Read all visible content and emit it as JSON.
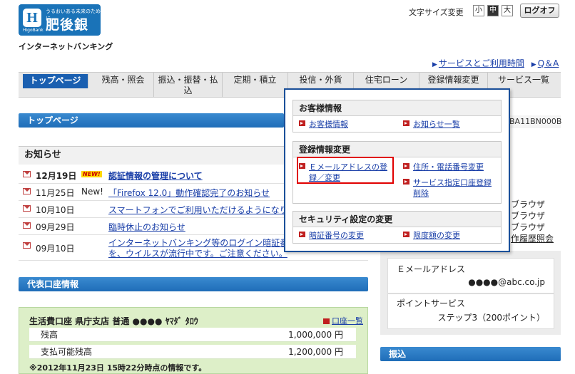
{
  "brand": {
    "logo_letter": "H",
    "tagline": "うるおいある未来のために。",
    "name": "肥後銀行",
    "sub": "HigoBank",
    "service": "インターネットバンキング"
  },
  "font_size": {
    "label": "文字サイズ変更",
    "small": "小",
    "medium": "中",
    "large": "大",
    "selected": "中"
  },
  "logout_label": "ログオフ",
  "top_links": {
    "arrow": "▶",
    "guide": "サービスとご利用時間",
    "qa": "Q＆A"
  },
  "nav": {
    "items": [
      {
        "label": "トップページ",
        "active": true
      },
      {
        "label": "残高・照会"
      },
      {
        "label": "振込・振替・払込"
      },
      {
        "label": "定期・積立"
      },
      {
        "label": "投信・外貨"
      },
      {
        "label": "住宅ローン"
      },
      {
        "label": "登録情報変更"
      },
      {
        "label": "サービス一覧"
      }
    ]
  },
  "page_title": "トップページ",
  "customer_code": "BA11BN000B",
  "news": {
    "title": "お知らせ",
    "items": [
      {
        "date": "12月19日",
        "new": "NEW!",
        "text": "認証情報の管理について",
        "bold": true
      },
      {
        "date": "11月25日",
        "new": "New!",
        "text": "「Firefox 12.0」動作確認完了のお知らせ"
      },
      {
        "date": "10月10日",
        "new": "",
        "text": "スマートフォンでご利用いただけるようになり"
      },
      {
        "date": "09月29日",
        "new": "",
        "text": "臨時休止のお知らせ"
      },
      {
        "date": "09月10日",
        "new": "",
        "text": "インターネットバンキング等のログイン暗証番",
        "text2": "を、ウイルスが流行中です。ご注意ください。"
      }
    ]
  },
  "account_section": {
    "title": "代表口座情報",
    "account_line": "生活費口座 県庁支店 普通 ●●●● ﾔﾏﾀﾞ ﾀﾛｳ",
    "account_link": "口座一覧",
    "balance_label": "残高",
    "balance_value": "1,000,000 円",
    "available_label": "支払可能残高",
    "available_value": "1,200,000 円",
    "note": "※2012年11月23日 15時22分時点の情報です。"
  },
  "right_panel": {
    "browser_lines": [
      "ブラウザ",
      "ブラウザ",
      "ブラウザ"
    ],
    "history_link": "作履歴照会",
    "email_label": "Ｅメールアドレス",
    "email_value": "●●●●@abc.co.jp",
    "point_label": "ポイントサービス",
    "point_value": "ステップ3（200ポイント）",
    "transfer_title": "振込"
  },
  "dropdown": {
    "customer": {
      "title": "お客様情報",
      "links": [
        "お客様情報",
        "お知らせ一覧"
      ]
    },
    "registration": {
      "title": "登録情報変更",
      "links": [
        "Ｅメールアドレスの登録／変更",
        "住所・電話番号変更",
        "サービス指定口座登録削除"
      ]
    },
    "security": {
      "title": "セキュリティ設定の変更",
      "links": [
        "暗証番号の変更",
        "限度額の変更"
      ]
    }
  },
  "colors": {
    "brand_blue": "#1a73b8",
    "nav_active": "#1a5fb0",
    "highlight": "#e00000",
    "account_bg": "#ddefc8"
  }
}
